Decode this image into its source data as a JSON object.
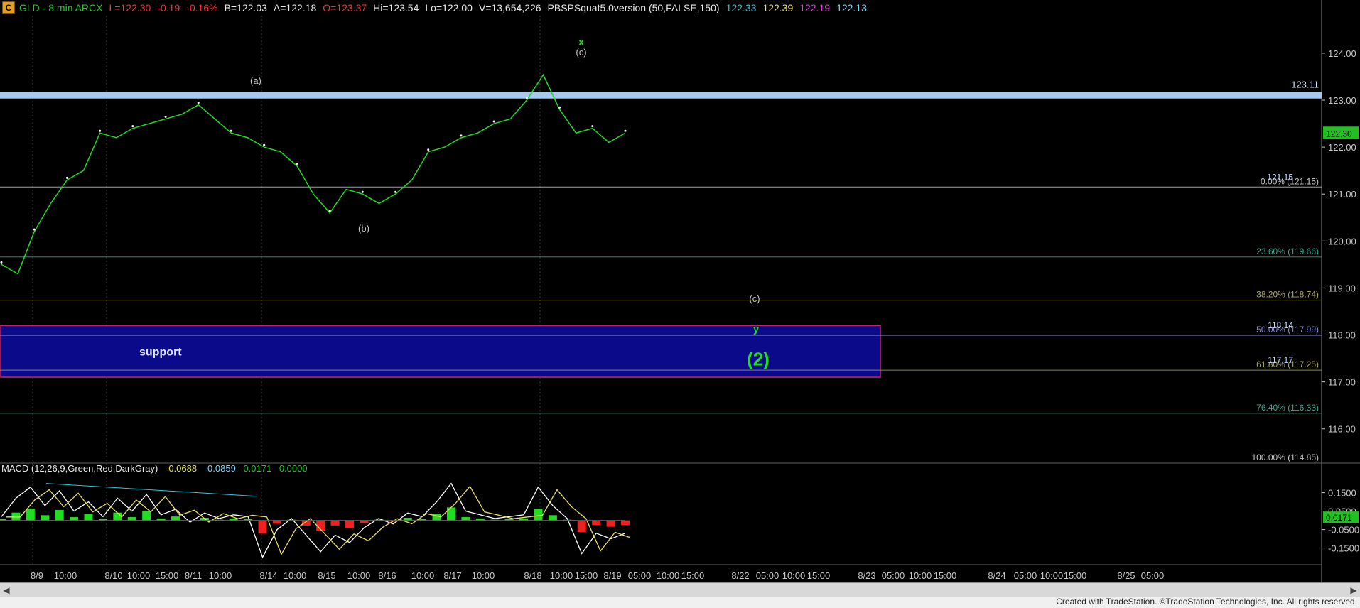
{
  "header": {
    "app_icon": "C",
    "title": "GLD - 8 min  ARCX",
    "last": "L=122.30",
    "change": "-0.19",
    "change_pct": "-0.16%",
    "bid": "B=122.03",
    "ask": "A=122.18",
    "open": "O=123.37",
    "high": "Hi=123.54",
    "low": "Lo=122.00",
    "volume": "V=13,654,226",
    "indicator": "PBSPSquat5.0version (50,FALSE,150)",
    "v1": "122.33",
    "v2": "122.39",
    "v3": "122.19",
    "v4": "122.13"
  },
  "price_axis": {
    "ticks": [
      "124.00",
      "123.00",
      "122.00",
      "121.00",
      "120.00",
      "119.00",
      "118.00",
      "117.00",
      "116.00"
    ],
    "ymin": 115.3,
    "ymax": 124.8,
    "current_label": "122.30",
    "current_value": 122.3
  },
  "macd_axis": {
    "ticks": [
      "0.1500",
      "0.0500",
      "-0.0500",
      "-0.1500"
    ],
    "values": [
      0.15,
      0.05,
      -0.05,
      -0.15
    ],
    "current_label": "0.0171",
    "ymin": -0.24,
    "ymax": 0.26
  },
  "levels": {
    "resistance": {
      "label": "123.11",
      "value": 123.11
    },
    "fib": [
      {
        "label": "0.00% (121.15)",
        "value": 121.15,
        "color": "#c8c8c8",
        "overlay": "121.15"
      },
      {
        "label": "23.60% (119.66)",
        "value": 119.66,
        "color": "#3aa890"
      },
      {
        "label": "38.20% (118.74)",
        "value": 118.74,
        "color": "#a8a858"
      },
      {
        "label": "50.00% (117.99)",
        "value": 117.99,
        "color": "#8888d8",
        "overlay": "118.14"
      },
      {
        "label": "61.80% (117.25)",
        "value": 117.25,
        "color": "#a8a858",
        "overlay": "117.17"
      },
      {
        "label": "76.40% (116.33)",
        "value": 116.33,
        "color": "#3aa890"
      },
      {
        "label": "100.00% (114.85)",
        "value": 114.85,
        "color": "#c8c8c8"
      }
    ]
  },
  "support_box": {
    "label": "support",
    "top": 118.2,
    "bottom": 117.1
  },
  "wave_labels": {
    "a": "(a)",
    "b": "(b)",
    "c": "(c)",
    "x": "x",
    "c2": "(c)",
    "y": "y",
    "two": "(2)"
  },
  "macd": {
    "title": "MACD (12,26,9,Green,Red,DarkGray)",
    "v1": "-0.0688",
    "v2": "-0.0859",
    "v3": "0.0171",
    "v4": "0.0000"
  },
  "time_axis": {
    "labels": [
      "8/9",
      "10:00",
      "8/10",
      "10:00",
      "15:00",
      "8/11",
      "10:00",
      "8/14",
      "10:00",
      "8/15",
      "10:00",
      "8/16",
      "10:00",
      "8/17",
      "10:00",
      "8/18",
      "10:00",
      "15:00",
      "8/19",
      "05:00",
      "10:00",
      "15:00",
      "8/22",
      "05:00",
      "10:00",
      "15:00",
      "8/23",
      "05:00",
      "10:00",
      "15:00",
      "8/24",
      "05:00",
      "10:00",
      "15:00",
      "8/25",
      "05:00"
    ],
    "positions": [
      52,
      92,
      160,
      195,
      235,
      272,
      310,
      378,
      415,
      460,
      505,
      545,
      595,
      637,
      680,
      750,
      790,
      825,
      862,
      900,
      940,
      975,
      1042,
      1080,
      1117,
      1152,
      1220,
      1257,
      1295,
      1330,
      1403,
      1443,
      1480,
      1513,
      1585,
      1622
    ]
  },
  "footer": "Created with TradeStation. ©TradeStation Technologies, Inc. All rights reserved.",
  "chart_data": {
    "type": "line",
    "series": [
      {
        "values": [
          119.5,
          119.3,
          120.2,
          120.8,
          121.3,
          121.5,
          122.3,
          122.2,
          122.4,
          122.5,
          122.6,
          122.7,
          122.9,
          122.6,
          122.3,
          122.2,
          122.0,
          121.9,
          121.6,
          121.0,
          120.6,
          121.1,
          121.0,
          120.8,
          121.0,
          121.3,
          121.9,
          122.0,
          122.2,
          122.3,
          122.5,
          122.6,
          123.0,
          123.54,
          122.8,
          122.3,
          122.4,
          122.1,
          122.3
        ]
      }
    ],
    "macd_fast": [
      0.02,
      0.12,
      0.18,
      0.08,
      0.16,
      0.05,
      0.1,
      0.02,
      0.12,
      0.05,
      0.14,
      0.03,
      0.06,
      -0.01,
      0.04,
      0.01,
      0.03,
      0.02,
      -0.2,
      -0.05,
      0.01,
      -0.08,
      -0.17,
      -0.08,
      -0.12,
      -0.04,
      0.01,
      -0.02,
      0.04,
      0.02,
      0.1,
      0.2,
      0.05,
      0.03,
      0.01,
      0.02,
      0.03,
      0.18,
      0.08,
      0.01,
      -0.18,
      -0.07,
      -0.1,
      -0.07
    ],
    "ylim": [
      115.3,
      124.8
    ]
  }
}
